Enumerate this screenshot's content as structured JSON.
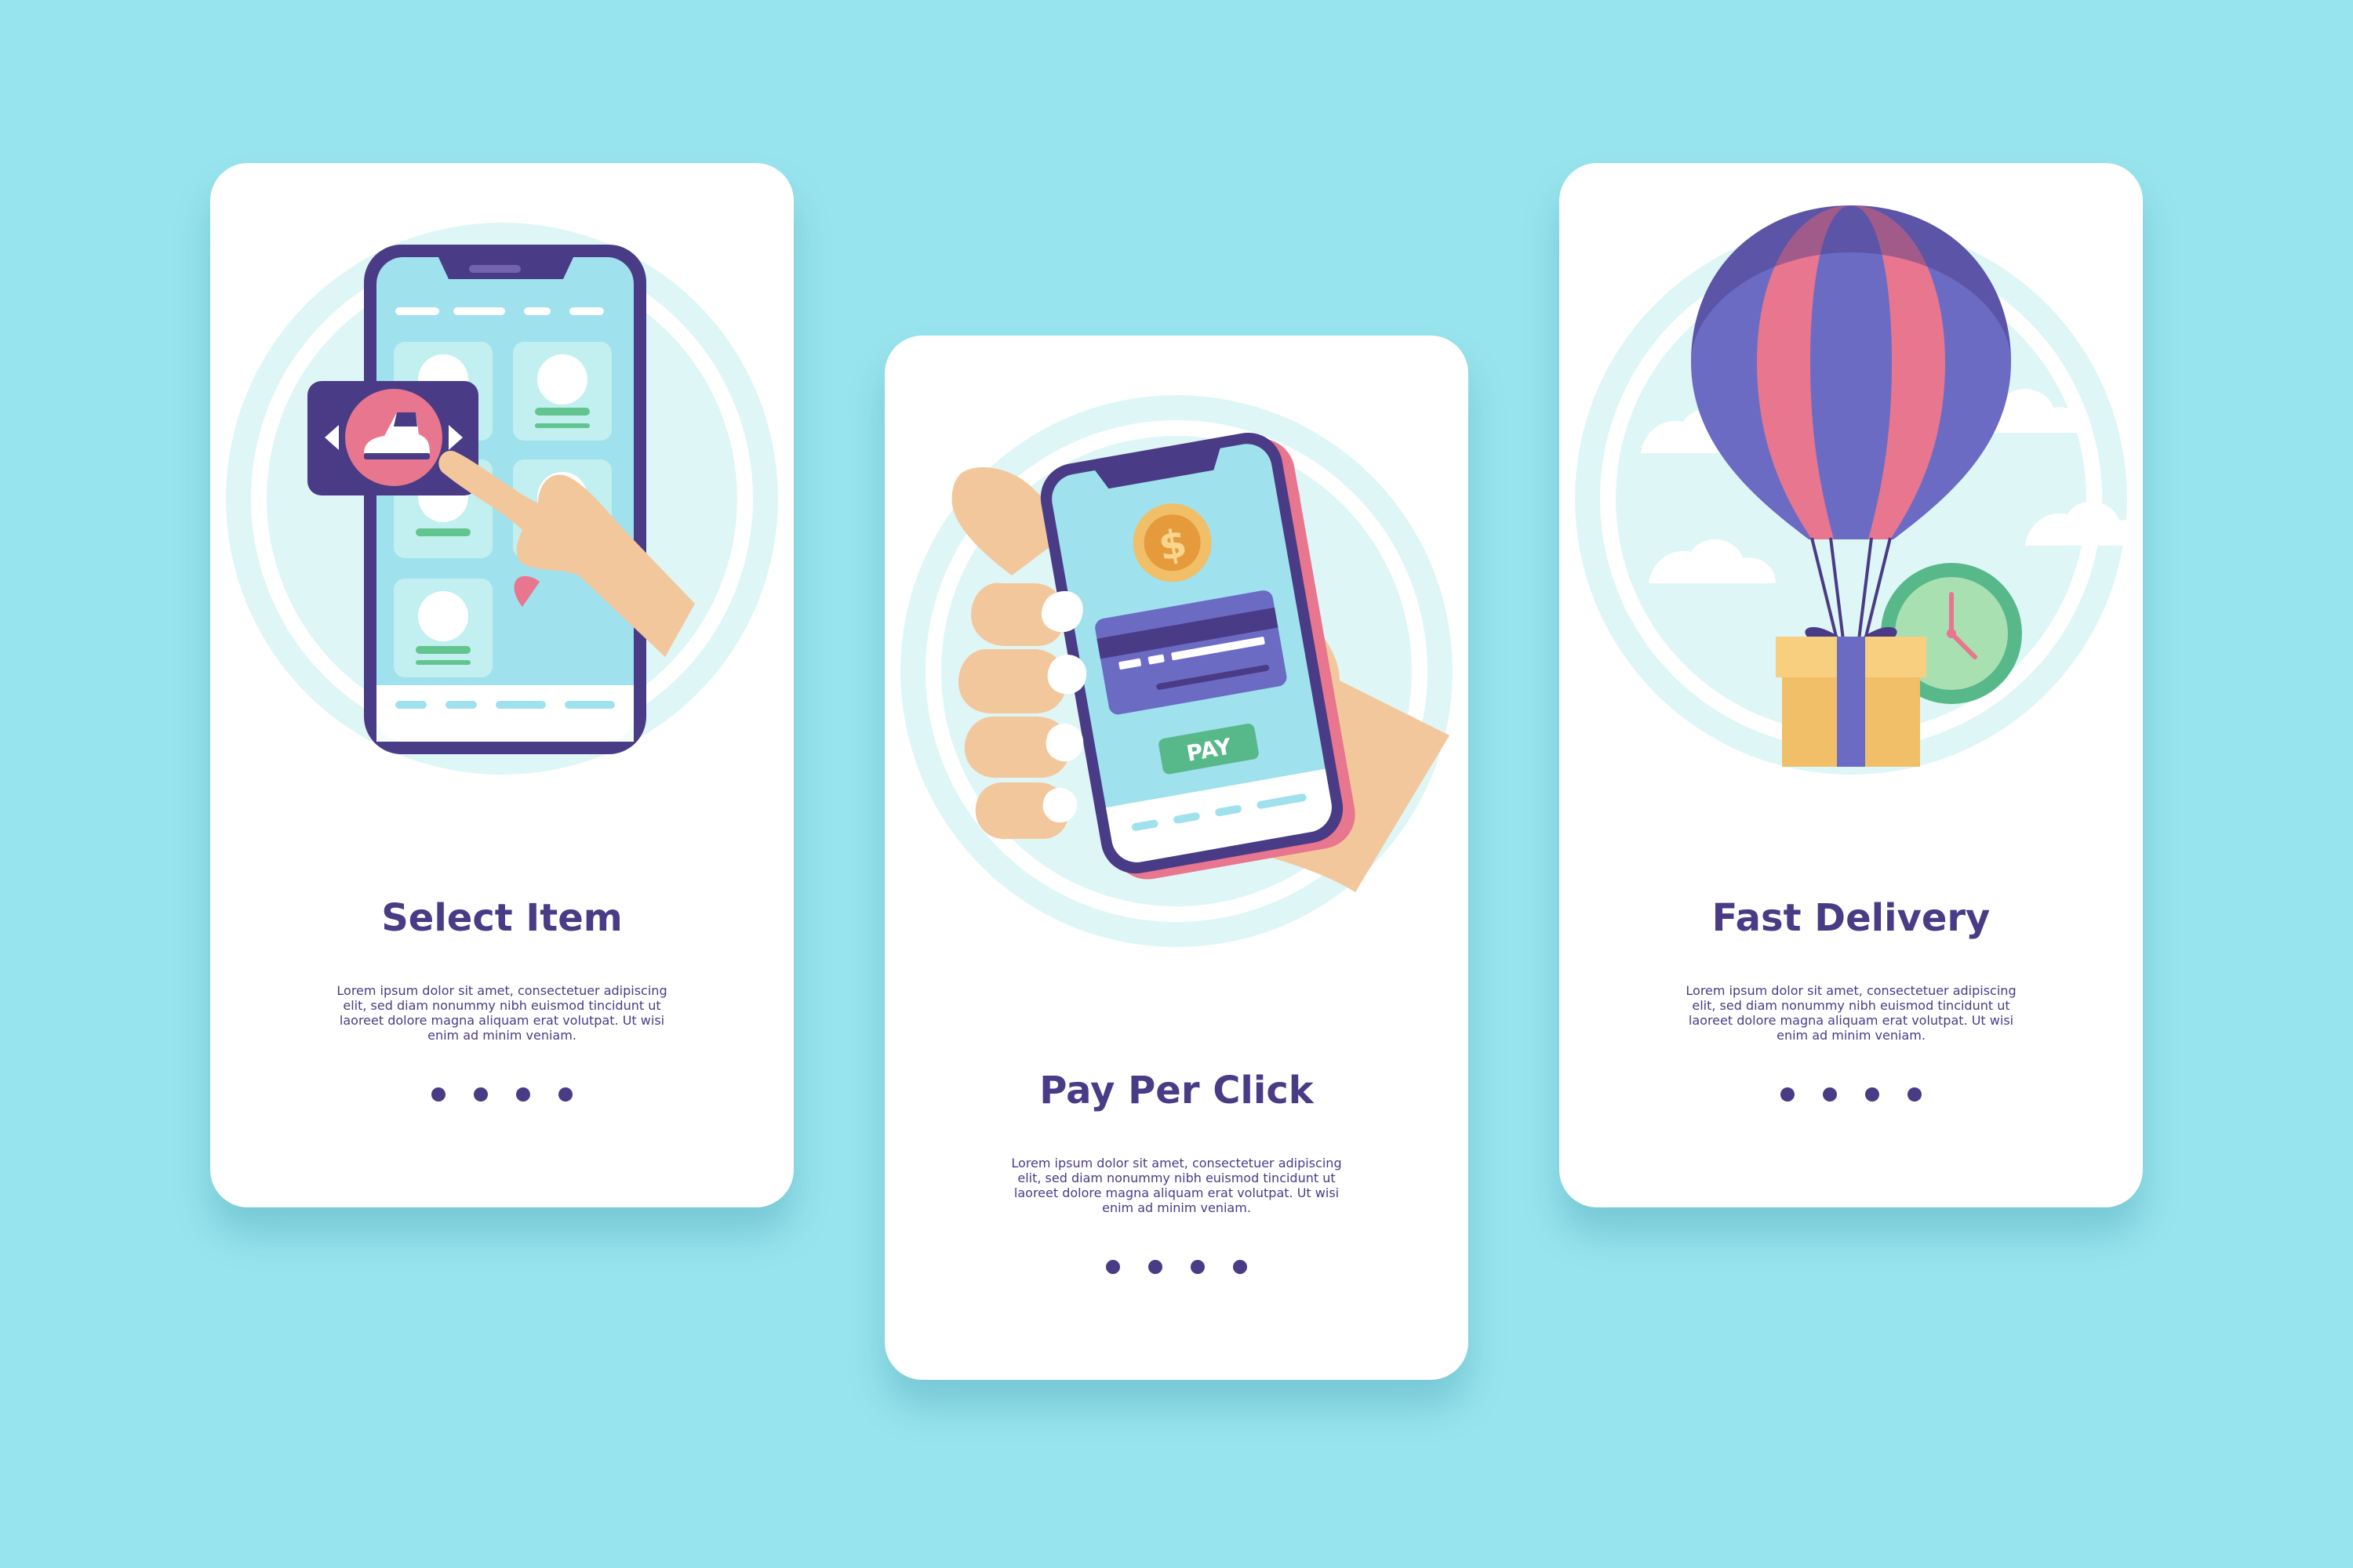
{
  "cards": [
    {
      "title": "Select Item",
      "description": "Lorem ipsum dolor sit amet, consectetuer adipiscing elit, sed diam nonummy nibh euismod tincidunt ut laoreet dolore magna aliquam erat volutpat. Ut wisi enim ad minim veniam."
    },
    {
      "title": "Pay Per Click",
      "description": "Lorem ipsum dolor sit amet, consectetuer adipiscing elit, sed diam nonummy nibh euismod tincidunt ut laoreet dolore magna aliquam erat volutpat. Ut wisi enim ad minim veniam.",
      "pay_button_label": "PAY",
      "coin_symbol": "$"
    },
    {
      "title": "Fast Delivery",
      "description": "Lorem ipsum dolor sit amet, consectetuer adipiscing elit, sed diam nonummy nibh euismod tincidunt ut laoreet dolore magna aliquam erat volutpat. Ut wisi enim ad minim veniam."
    }
  ],
  "colors": {
    "background": "#97e4ee",
    "card": "#ffffff",
    "text": "#4a3b86",
    "ring": "#dff6f7",
    "screen": "#9fe1ed",
    "pink": "#e7768e",
    "purple": "#6c6bc4",
    "skin": "#f3c79c",
    "green": "#57b88a",
    "box": "#f1bf67"
  },
  "icons": [
    "sneaker-icon",
    "chevron-left-icon",
    "chevron-right-icon",
    "dollar-coin-icon",
    "credit-card-icon",
    "hot-air-balloon-icon",
    "clock-icon",
    "gift-box-icon",
    "cloud-icon",
    "pointing-hand-icon"
  ]
}
